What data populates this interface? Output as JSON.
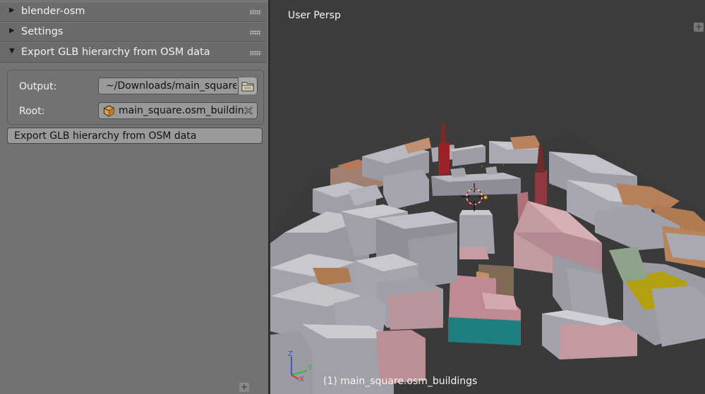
{
  "panels": {
    "blender_osm": {
      "title": "blender-osm",
      "expanded": false
    },
    "settings": {
      "title": "Settings",
      "expanded": false
    },
    "export": {
      "title": "Export GLB hierarchy from OSM data",
      "expanded": true
    }
  },
  "form": {
    "output_label": "Output:",
    "output_value": "~/Downloads/main_square",
    "root_label": "Root:",
    "root_value": "main_square.osm_buildin...",
    "export_button": "Export GLB hierarchy from OSM data"
  },
  "viewport": {
    "title": "User Persp",
    "status": "(1) main_square.osm_buildings",
    "axes": {
      "x": "X",
      "y": "Y",
      "z": "Z"
    }
  },
  "icons": {
    "expand": "triangle-right",
    "collapse": "triangle-down",
    "folder": "folder-icon",
    "object": "cube-icon",
    "clear": "x-circle-icon"
  },
  "colors": {
    "panel_bg": "#727272",
    "viewport_bg": "#3d3d3d",
    "building_grey": "#a3a3ab",
    "building_pink": "#c79ca0",
    "building_orange": "#b0784c",
    "building_teal": "#1e7f80",
    "building_red": "#9a2228",
    "building_yellow": "#b3a010"
  }
}
